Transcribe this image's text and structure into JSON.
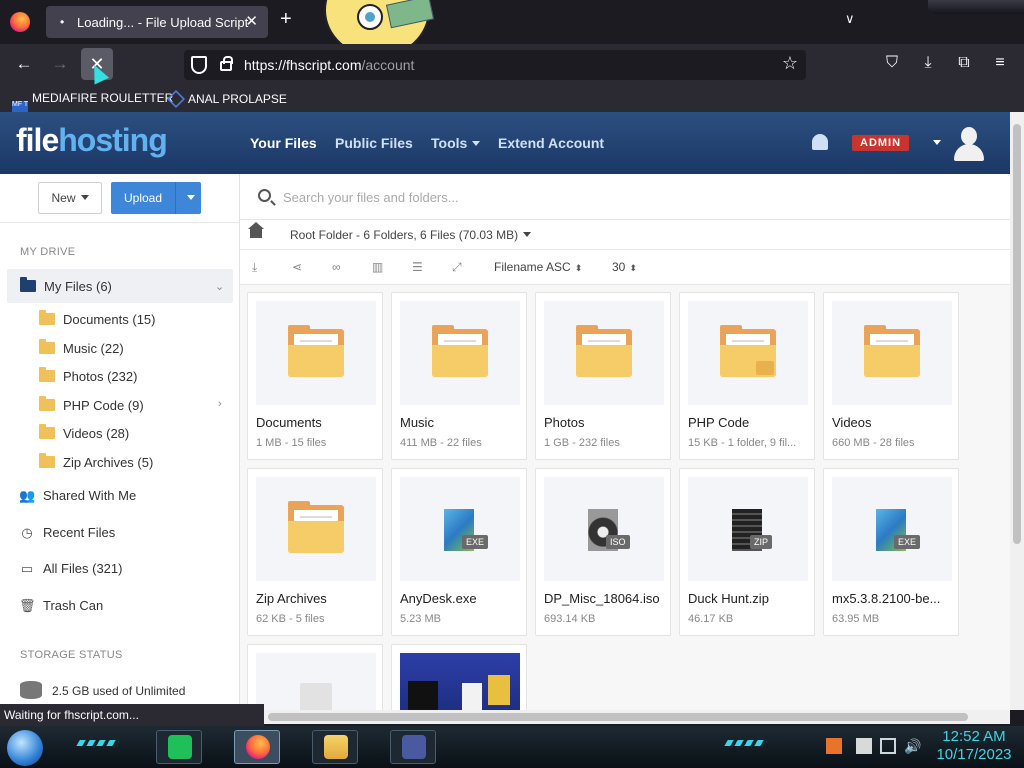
{
  "browser": {
    "tab_indicator": "•",
    "tab_title": "Loading... - File Upload Script",
    "tab_close": "✕",
    "new_tab": "+",
    "tab_list": "∨",
    "url_domain": "https://fhscript.com",
    "url_path": "/account",
    "back": "←",
    "forward": "→",
    "stop": "✕",
    "bookmark_star": "☆",
    "toolbar_icons": [
      "pocket-icon",
      "downloads-icon",
      "extensions-icon",
      "menu-icon"
    ],
    "bookmarks": [
      {
        "label": "MEDIAFIRE ROULETTER",
        "icon": "MF T"
      },
      {
        "label": "ANAL PROLAPSE",
        "icon": ""
      }
    ],
    "status": "Waiting for fhscript.com..."
  },
  "site": {
    "logo_a": "file",
    "logo_b": "hosting",
    "nav": [
      "Your Files",
      "Public Files",
      "Tools",
      "Extend Account"
    ],
    "admin_badge": "ADMIN",
    "colors": {
      "header": "#1b3866",
      "accent": "#3e86d8",
      "badge": "#c8352f",
      "folder": "#f6cc68"
    }
  },
  "sidebar": {
    "new_label": "New",
    "upload_label": "Upload",
    "my_drive": "MY DRIVE",
    "my_files": "My Files (6)",
    "folders": [
      "Documents (15)",
      "Music (22)",
      "Photos (232)",
      "PHP Code (9)",
      "Videos (28)",
      "Zip Archives (5)"
    ],
    "links": [
      "Shared With Me",
      "Recent Files",
      "All Files (321)",
      "Trash Can"
    ],
    "storage_title": "STORAGE STATUS",
    "storage_text": "2.5 GB used of Unlimited"
  },
  "main": {
    "search_placeholder": "Search your files and folders...",
    "breadcrumb": "Root Folder - 6 Folders, 6 Files (70.03 MB)",
    "sort_label": "Filename ASC",
    "per_page": "30",
    "items": [
      {
        "name": "Documents",
        "meta": "1 MB - 15 files",
        "kind": "folder"
      },
      {
        "name": "Music",
        "meta": "411 MB - 22 files",
        "kind": "folder"
      },
      {
        "name": "Photos",
        "meta": "1 GB - 232 files",
        "kind": "folder"
      },
      {
        "name": "PHP Code",
        "meta": "15 KB - 1 folder, 9 fil...",
        "kind": "folder-locked"
      },
      {
        "name": "Videos",
        "meta": "660 MB - 28 files",
        "kind": "folder"
      },
      {
        "name": "Zip Archives",
        "meta": "62 KB - 5 files",
        "kind": "folder"
      },
      {
        "name": "AnyDesk.exe",
        "meta": "5.23 MB",
        "kind": "exe",
        "tag": "EXE"
      },
      {
        "name": "DP_Misc_18064.iso",
        "meta": "693.14 KB",
        "kind": "iso",
        "tag": "ISO"
      },
      {
        "name": "Duck Hunt.zip",
        "meta": "46.17 KB",
        "kind": "zip",
        "tag": "ZIP"
      },
      {
        "name": "mx5.3.8.2100-be...",
        "meta": "63.95 MB",
        "kind": "exe",
        "tag": "EXE"
      }
    ]
  },
  "taskbar": {
    "time": "12:52 AM",
    "date": "10/17/2023"
  }
}
